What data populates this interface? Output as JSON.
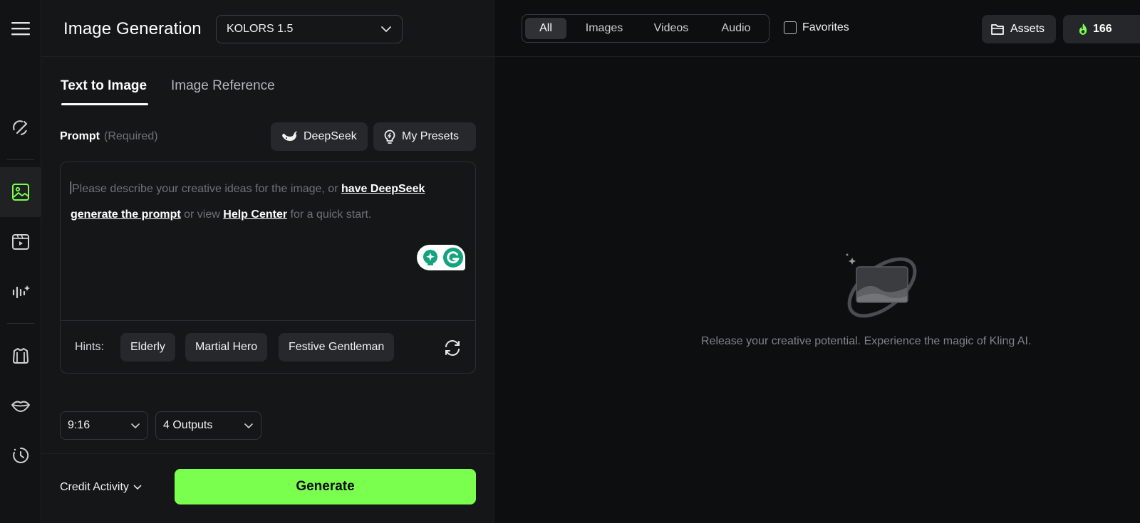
{
  "header": {
    "title": "Image Generation",
    "model": "KOLORS 1.5"
  },
  "tabs": [
    {
      "label": "Text to Image",
      "active": true
    },
    {
      "label": "Image Reference",
      "active": false
    }
  ],
  "prompt": {
    "label": "Prompt",
    "required": "(Required)",
    "deepseek_label": "DeepSeek",
    "presets_label": "My Presets",
    "placeholder_1": "Please describe your creative ideas for the image, or ",
    "link_1": "have DeepSeek generate the prompt",
    "placeholder_2": " or view ",
    "link_2": "Help Center",
    "placeholder_3": " for a quick start."
  },
  "hints": {
    "label": "Hints:",
    "items": [
      "Elderly",
      "Martial Hero",
      "Festive Gentleman"
    ]
  },
  "settings": {
    "aspect_ratio": "9:16",
    "outputs": "4 Outputs"
  },
  "footer": {
    "credit_label": "Credit Activity",
    "generate_label": "Generate"
  },
  "filter_tabs": [
    {
      "label": "All",
      "active": true
    },
    {
      "label": "Images",
      "active": false
    },
    {
      "label": "Videos",
      "active": false
    },
    {
      "label": "Audio",
      "active": false
    }
  ],
  "favorites_label": "Favorites",
  "assets_label": "Assets",
  "credits": "166",
  "empty_state": "Release your creative potential. Experience the magic of Kling AI.",
  "colors": {
    "accent": "#7bff4f",
    "background": "#0d0e0f",
    "panel": "#151618",
    "chip": "#26282b"
  },
  "icons": {
    "rail": [
      "menu-icon",
      "magic-edit-icon",
      "image-icon",
      "video-icon",
      "audio-icon",
      "shirt-icon",
      "lips-icon",
      "history-icon"
    ],
    "header": [
      "chevron-down-icon",
      "folder-icon",
      "flame-icon"
    ]
  }
}
